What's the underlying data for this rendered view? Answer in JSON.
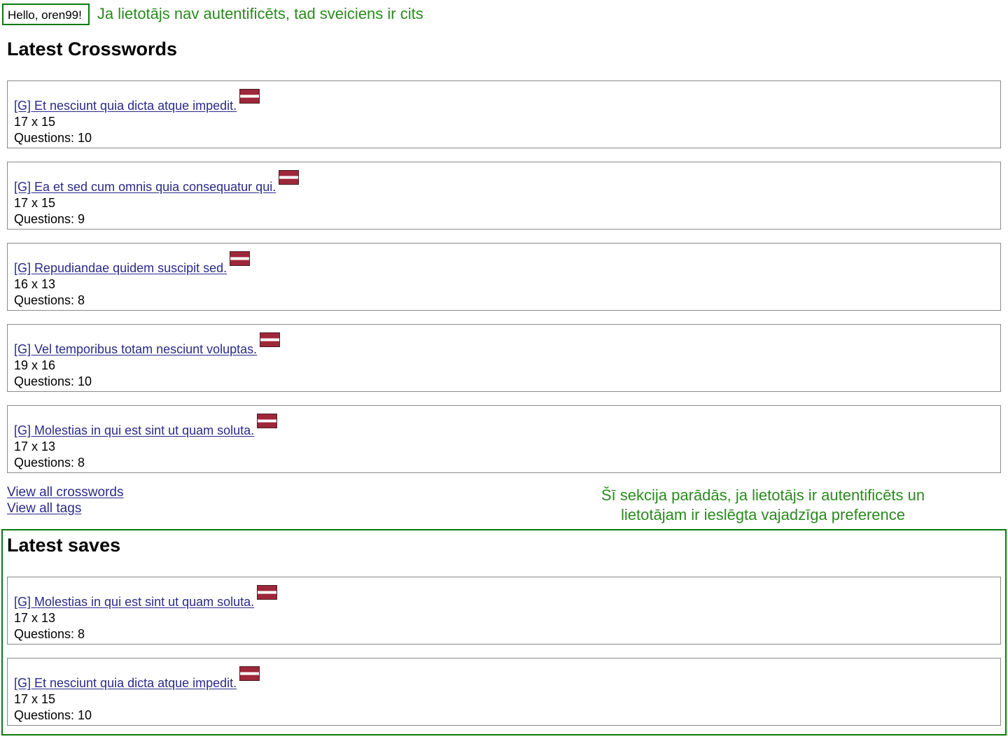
{
  "greeting": {
    "text": "Hello, oren99!",
    "annotation": "Ja lietotājs nav autentificēts, tad sveiciens ir cits"
  },
  "latest": {
    "title": "Latest Crosswords",
    "items": [
      {
        "title": "[G] Et nesciunt quia dicta atque impedit.",
        "size": "17 x 15",
        "questions": "Questions: 10",
        "flag": "latvia-flag-icon"
      },
      {
        "title": "[G] Ea et sed cum omnis quia consequatur qui.",
        "size": "17 x 15",
        "questions": "Questions: 9",
        "flag": "latvia-flag-icon"
      },
      {
        "title": "[G] Repudiandae quidem suscipit sed.",
        "size": "16 x 13",
        "questions": "Questions: 8",
        "flag": "latvia-flag-icon"
      },
      {
        "title": "[G] Vel temporibus totam nesciunt voluptas.",
        "size": "19 x 16",
        "questions": "Questions: 10",
        "flag": "latvia-flag-icon"
      },
      {
        "title": "[G] Molestias in qui est sint ut quam soluta.",
        "size": "17 x 13",
        "questions": "Questions: 8",
        "flag": "latvia-flag-icon"
      }
    ]
  },
  "links": {
    "view_all_crosswords": "View all crosswords",
    "view_all_tags": "View all tags"
  },
  "saves": {
    "annotation_line1": "Šī sekcija parādās, ja lietotājs ir autentificēts un",
    "annotation_line2": "lietotājam ir ieslēgta vajadzīga preference",
    "title": "Latest saves",
    "items": [
      {
        "title": "[G] Molestias in qui est sint ut quam soluta.",
        "size": "17 x 13",
        "questions": "Questions: 8",
        "flag": "latvia-flag-icon"
      },
      {
        "title": "[G] Et nesciunt quia dicta atque impedit.",
        "size": "17 x 15",
        "questions": "Questions: 10",
        "flag": "latvia-flag-icon"
      }
    ]
  },
  "colors": {
    "annotation_green": "#2a8a1e",
    "frame_green": "#0a7a0a",
    "link": "#2a2a8a",
    "flag_red": "#9e2739"
  }
}
